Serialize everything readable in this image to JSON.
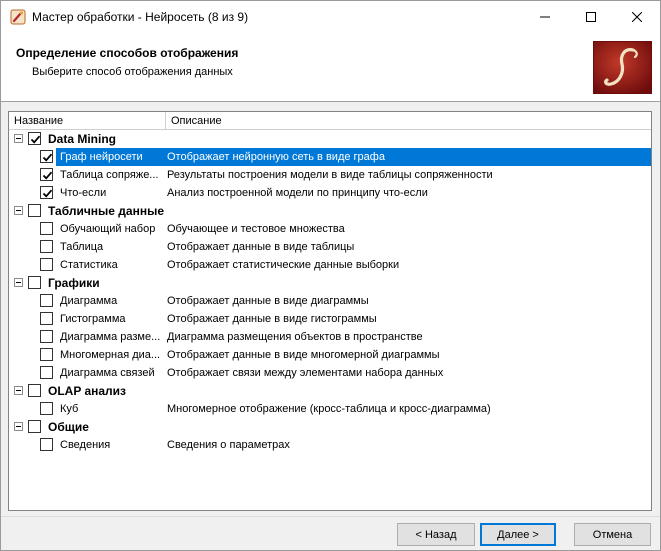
{
  "window": {
    "title": "Мастер обработки - Нейросеть (8 из 9)"
  },
  "header": {
    "title": "Определение способов отображения",
    "subtitle": "Выберите способ отображения данных"
  },
  "columns": {
    "name": "Название",
    "description": "Описание"
  },
  "groups": [
    {
      "label": "Data Mining",
      "checked": true,
      "items": [
        {
          "label": "Граф нейросети",
          "description": "Отображает нейронную сеть в виде графа",
          "checked": true,
          "selected": true
        },
        {
          "label": "Таблица сопряже...",
          "description": "Результаты построения модели в виде таблицы сопряженности",
          "checked": true
        },
        {
          "label": "Что-если",
          "description": "Анализ построенной модели по принципу что-если",
          "checked": true
        }
      ]
    },
    {
      "label": "Табличные данные",
      "checked": false,
      "items": [
        {
          "label": "Обучающий набор",
          "description": "Обучающее и тестовое множества",
          "checked": false
        },
        {
          "label": "Таблица",
          "description": "Отображает данные в виде таблицы",
          "checked": false
        },
        {
          "label": "Статистика",
          "description": "Отображает статистические данные выборки",
          "checked": false
        }
      ]
    },
    {
      "label": "Графики",
      "checked": false,
      "items": [
        {
          "label": "Диаграмма",
          "description": "Отображает данные в виде диаграммы",
          "checked": false
        },
        {
          "label": "Гистограмма",
          "description": "Отображает данные в виде гистограммы",
          "checked": false
        },
        {
          "label": "Диаграмма разме...",
          "description": "Диаграмма размещения объектов в пространстве",
          "checked": false
        },
        {
          "label": "Многомерная диа...",
          "description": "Отображает данные в виде многомерной диаграммы",
          "checked": false
        },
        {
          "label": "Диаграмма связей",
          "description": "Отображает связи между элементами набора данных",
          "checked": false
        }
      ]
    },
    {
      "label": "OLAP анализ",
      "checked": false,
      "items": [
        {
          "label": "Куб",
          "description": "Многомерное отображение (кросс-таблица и кросс-диаграмма)",
          "checked": false
        }
      ]
    },
    {
      "label": "Общие",
      "checked": false,
      "items": [
        {
          "label": "Сведения",
          "description": "Сведения о параметрах",
          "checked": false
        }
      ]
    }
  ],
  "buttons": {
    "back": "< Назад",
    "next": "Далее >",
    "cancel": "Отмена"
  },
  "icons": {
    "app": "wand-icon",
    "logo": "deductor-logo",
    "minimize": "minimize-icon",
    "maximize": "maximize-icon",
    "close": "close-icon",
    "check": "check-icon",
    "collapse": "collapse-icon"
  },
  "colors": {
    "selection": "#0078d7",
    "logo_bg": "#8b1a1a",
    "accent_border": "#0078d7"
  }
}
